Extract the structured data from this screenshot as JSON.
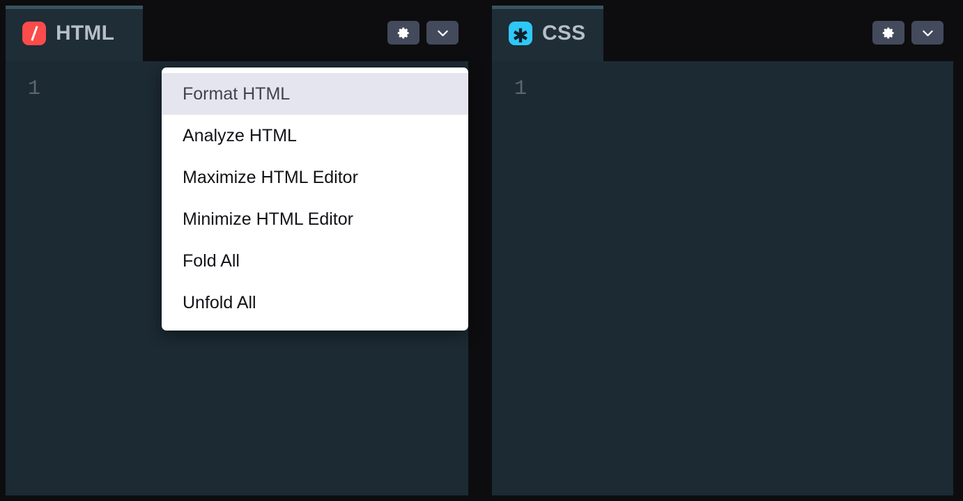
{
  "panes": [
    {
      "id": "html",
      "tab": {
        "label": "HTML",
        "icon": "slash-icon",
        "icon_color": "#fc4b4b"
      },
      "actions": [
        {
          "name": "settings-button",
          "icon": "gear-icon"
        },
        {
          "name": "menu-button",
          "icon": "chevron-down-icon"
        }
      ],
      "gutter": {
        "lines": [
          "1"
        ]
      },
      "code": ""
    },
    {
      "id": "css",
      "tab": {
        "label": "CSS",
        "icon": "asterisk-icon",
        "icon_color": "#2fc7f7"
      },
      "actions": [
        {
          "name": "settings-button",
          "icon": "gear-icon"
        },
        {
          "name": "menu-button",
          "icon": "chevron-down-icon"
        }
      ],
      "gutter": {
        "lines": [
          "1"
        ]
      },
      "code": ""
    }
  ],
  "dropdown": {
    "open": true,
    "owner": "html",
    "items": [
      {
        "label": "Format HTML",
        "active": true
      },
      {
        "label": "Analyze HTML",
        "active": false
      },
      {
        "label": "Maximize HTML Editor",
        "active": false
      },
      {
        "label": "Minimize HTML Editor",
        "active": false
      },
      {
        "label": "Fold All",
        "active": false
      },
      {
        "label": "Unfold All",
        "active": false
      }
    ]
  },
  "theme": {
    "page_background": "#0d0d0f",
    "editor_background": "#1c2a33",
    "tab_background": "#1e2d36",
    "tab_accent": "#37545f",
    "button_background": "#434a5c",
    "menu_background": "#ffffff",
    "menu_active_background": "#e5e5ef",
    "line_number_color": "#5c6870",
    "tab_label_color": "#b6bec9"
  }
}
